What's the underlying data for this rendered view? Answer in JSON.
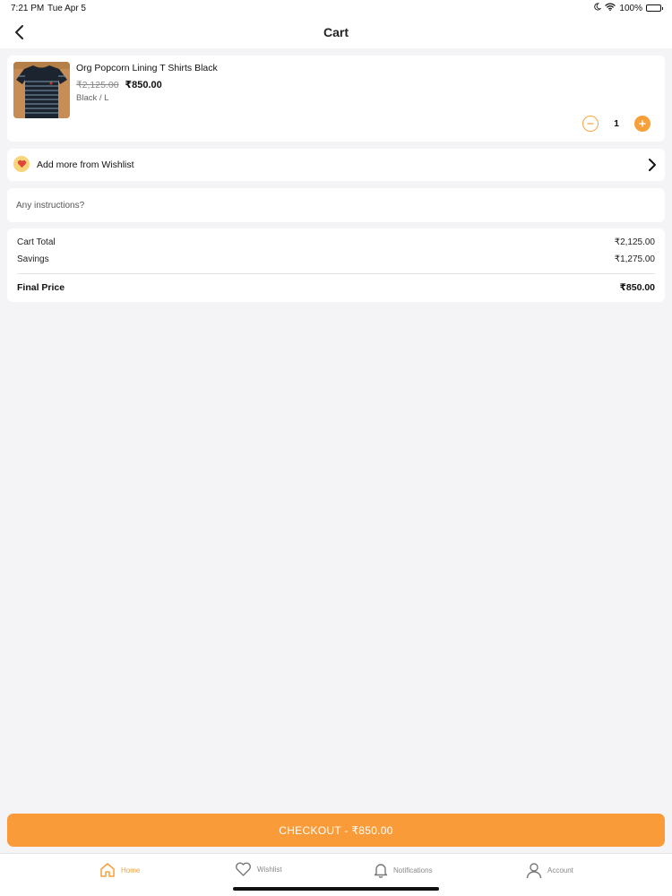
{
  "status_bar": {
    "time": "7:21 PM",
    "date": "Tue Apr 5",
    "battery": "100%"
  },
  "nav": {
    "title": "Cart"
  },
  "cart_item": {
    "name": "Org Popcorn Lining T Shirts Black",
    "old_price": "₹2,125.00",
    "price": "₹850.00",
    "variant": "Black / L",
    "quantity": "1"
  },
  "wishlist": {
    "label": "Add more from Wishlist"
  },
  "instructions": {
    "placeholder": "Any instructions?"
  },
  "summary": {
    "cart_total_label": "Cart Total",
    "cart_total_value": "₹2,125.00",
    "savings_label": "Savings",
    "savings_value": "₹1,275.00",
    "final_label": "Final Price",
    "final_value": "₹850.00"
  },
  "checkout": {
    "label": "CHECKOUT - ₹850.00"
  },
  "tabs": [
    {
      "label": "Home",
      "icon": "home-icon"
    },
    {
      "label": "Wishlist",
      "icon": "heart-icon"
    },
    {
      "label": "Notifications",
      "icon": "bell-icon"
    },
    {
      "label": "Account",
      "icon": "person-icon"
    }
  ],
  "colors": {
    "accent": "#f99b38",
    "background": "#f4f3f6"
  }
}
